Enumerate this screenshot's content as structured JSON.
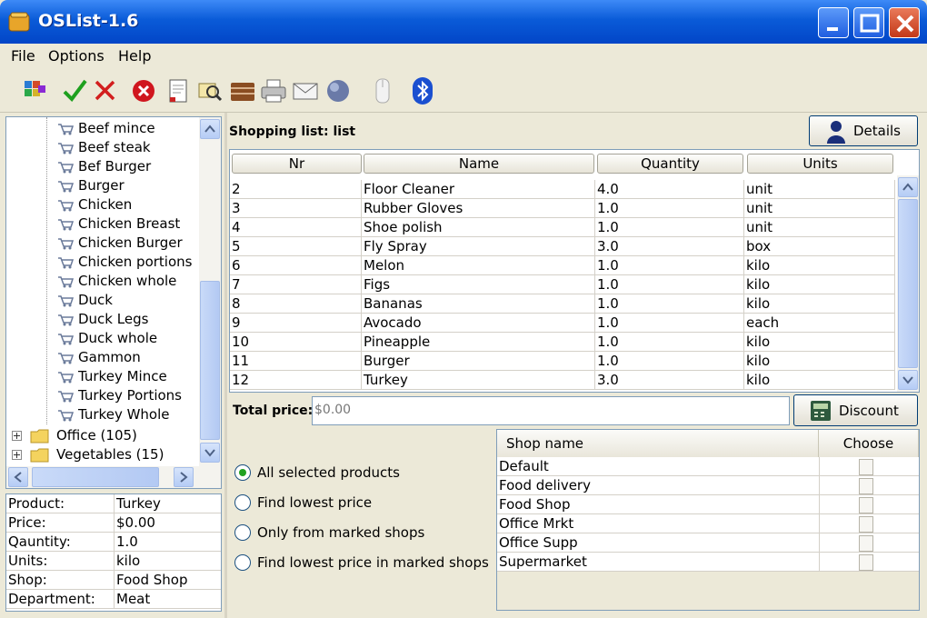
{
  "window": {
    "title": "OSList-1.6"
  },
  "menu": [
    {
      "label": "File"
    },
    {
      "label": "Options"
    },
    {
      "label": "Help"
    }
  ],
  "toolbar": [
    {
      "icon": "categories-icon"
    },
    {
      "icon": "check-icon"
    },
    {
      "icon": "x-icon"
    },
    {
      "icon": "delete-icon"
    },
    {
      "icon": "edit-list-icon"
    },
    {
      "icon": "find-icon"
    },
    {
      "icon": "shops-icon"
    },
    {
      "icon": "print-icon"
    },
    {
      "icon": "mail-icon"
    },
    {
      "icon": "globe-icon"
    },
    {
      "icon": "mobile-icon"
    },
    {
      "icon": "bluetooth-icon"
    }
  ],
  "tree": {
    "items": [
      {
        "label": "Beef mince"
      },
      {
        "label": "Beef steak"
      },
      {
        "label": "Bef Burger"
      },
      {
        "label": "Burger"
      },
      {
        "label": "Chicken"
      },
      {
        "label": "Chicken Breast"
      },
      {
        "label": "Chicken Burger"
      },
      {
        "label": "Chicken portions"
      },
      {
        "label": "Chicken whole"
      },
      {
        "label": "Duck"
      },
      {
        "label": "Duck Legs"
      },
      {
        "label": "Duck whole"
      },
      {
        "label": "Gammon"
      },
      {
        "label": "Turkey Mince"
      },
      {
        "label": "Turkey Portions"
      },
      {
        "label": "Turkey Whole"
      }
    ],
    "folders": [
      {
        "label": "Office (105)"
      },
      {
        "label": "Vegetables (15)"
      }
    ]
  },
  "product": {
    "rows": [
      {
        "key": "Product:",
        "value": "Turkey"
      },
      {
        "key": "Price:",
        "value": "$0.00"
      },
      {
        "key": "Qauntity:",
        "value": "1.0"
      },
      {
        "key": "Units:",
        "value": "kilo"
      },
      {
        "key": "Shop:",
        "value": "Food Shop"
      },
      {
        "key": "Department:",
        "value": "Meat"
      }
    ]
  },
  "shopping": {
    "title": "Shopping list: list",
    "details_label": "Details",
    "columns": [
      "Nr",
      "Name",
      "Quantity",
      "Units"
    ],
    "rows": [
      {
        "nr": "2",
        "name": "Floor Cleaner",
        "qty": "4.0",
        "units": "unit"
      },
      {
        "nr": "3",
        "name": "Rubber Gloves",
        "qty": "1.0",
        "units": "unit"
      },
      {
        "nr": "4",
        "name": "Shoe polish",
        "qty": "1.0",
        "units": "unit"
      },
      {
        "nr": "5",
        "name": "Fly Spray",
        "qty": "3.0",
        "units": "box"
      },
      {
        "nr": "6",
        "name": "Melon",
        "qty": "1.0",
        "units": "kilo"
      },
      {
        "nr": "7",
        "name": "Figs",
        "qty": "1.0",
        "units": "kilo"
      },
      {
        "nr": "8",
        "name": "Bananas",
        "qty": "1.0",
        "units": "kilo"
      },
      {
        "nr": "9",
        "name": "Avocado",
        "qty": "1.0",
        "units": "each"
      },
      {
        "nr": "10",
        "name": "Pineapple",
        "qty": "1.0",
        "units": "kilo"
      },
      {
        "nr": "11",
        "name": "Burger",
        "qty": "1.0",
        "units": "kilo"
      },
      {
        "nr": "12",
        "name": "Turkey",
        "qty": "3.0",
        "units": "kilo"
      }
    ],
    "total_label": "Total price:",
    "total_value": "$0.00",
    "discount_label": "Discount"
  },
  "options": [
    {
      "label": "All selected products",
      "selected": true
    },
    {
      "label": "Find lowest price",
      "selected": false
    },
    {
      "label": "Only from marked shops",
      "selected": false
    },
    {
      "label": "Find lowest price in marked shops",
      "selected": false
    }
  ],
  "shops": {
    "columns": [
      "Shop name",
      "Choose"
    ],
    "rows": [
      {
        "name": "Default"
      },
      {
        "name": "Food delivery"
      },
      {
        "name": "Food Shop"
      },
      {
        "name": "Office Mrkt"
      },
      {
        "name": "Office Supp"
      },
      {
        "name": "Supermarket"
      }
    ]
  }
}
